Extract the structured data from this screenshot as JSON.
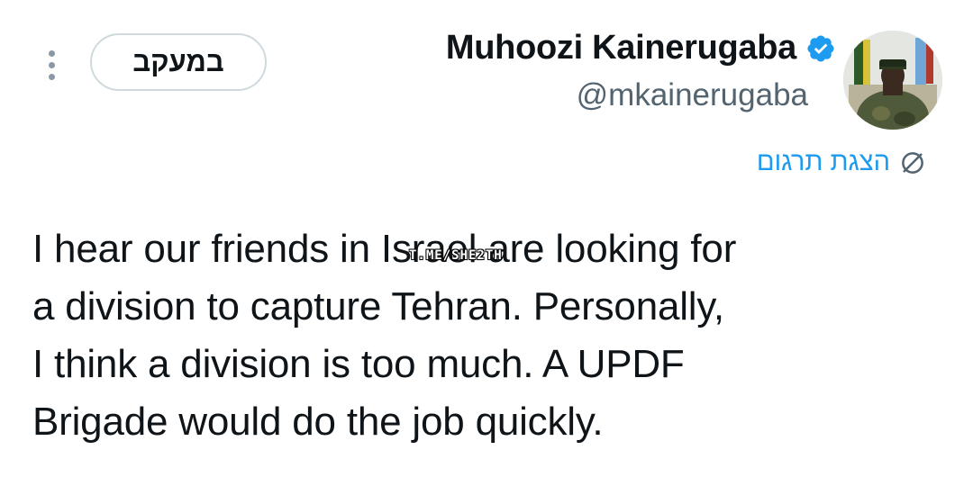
{
  "author": {
    "display_name": "Muhoozi Kainerugaba",
    "handle": "@mkainerugaba",
    "verified": true,
    "accent_color": "#1d9bf0"
  },
  "actions": {
    "follow_label": "במעקב",
    "more_icon": "more-vertical-icon"
  },
  "translate": {
    "label": "הצגת תרגום",
    "icon": "globe-icon"
  },
  "tweet": {
    "lines": [
      "I hear our friends in Israel are looking for",
      "a division to capture Tehran. Personally,",
      "I think a division is too much. A UPDF",
      "Brigade would do the job quickly."
    ]
  },
  "overlay": {
    "watermark": "T.ME/SHE2TH"
  }
}
